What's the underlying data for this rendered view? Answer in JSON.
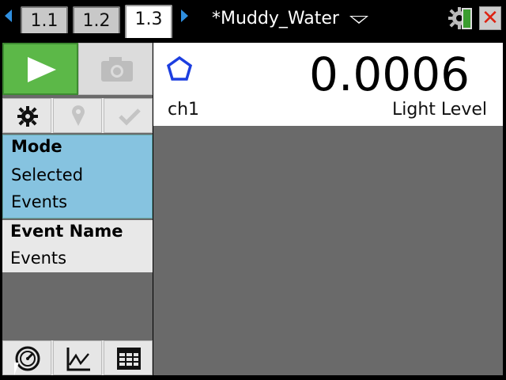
{
  "tabs": [
    {
      "label": "1.1",
      "active": false
    },
    {
      "label": "1.2",
      "active": false
    },
    {
      "label": "1.3",
      "active": true
    }
  ],
  "document_title": "*Muddy_Water",
  "meter": {
    "value": "0.0006",
    "channel": "ch1",
    "sensor_name": "Light Level"
  },
  "mode": {
    "heading": "Mode",
    "line1": "Selected",
    "line2": "Events"
  },
  "event_name": {
    "heading": "Event Name",
    "value": "Events"
  },
  "colors": {
    "play_green": "#5cb848",
    "mode_blue": "#86c3e0",
    "pentagon_blue": "#1c3ee0",
    "close_red": "#d21111"
  }
}
